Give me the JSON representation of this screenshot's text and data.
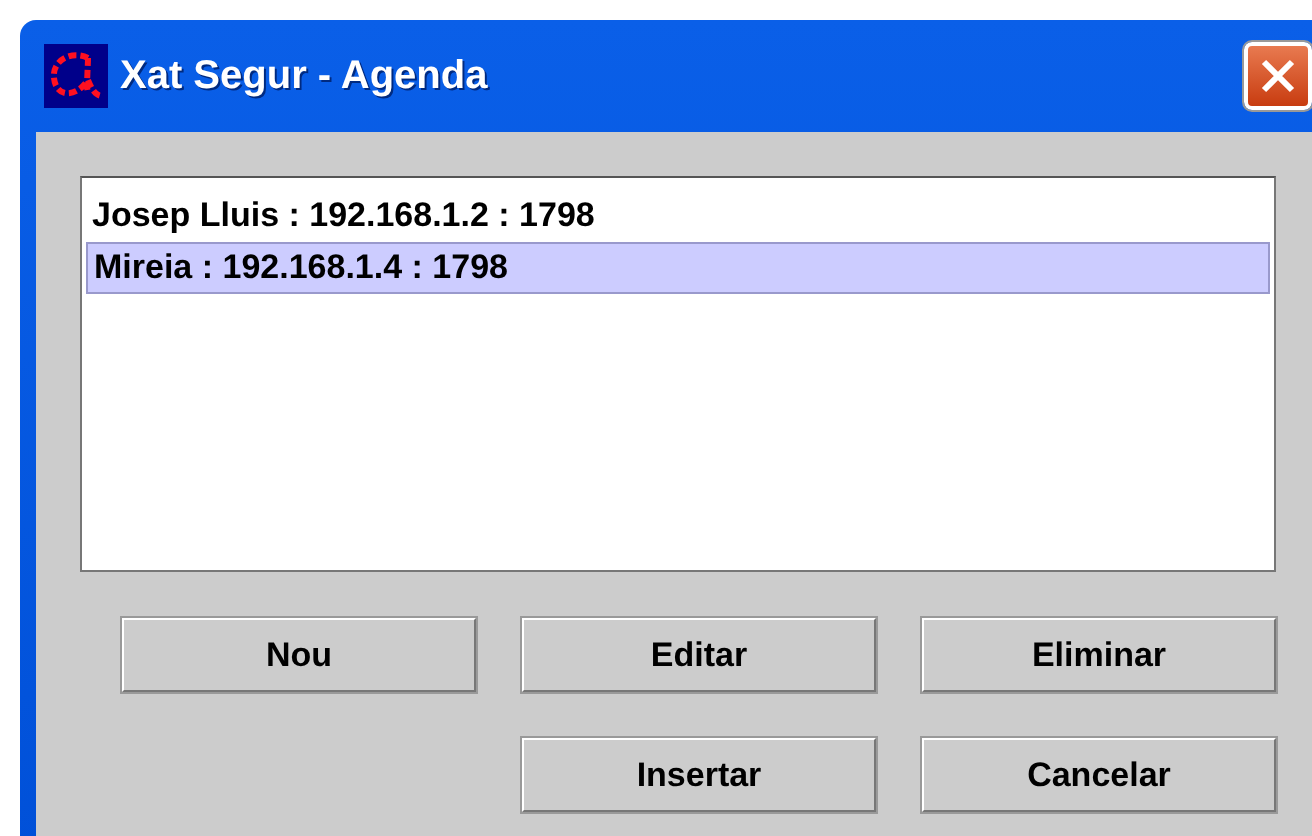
{
  "window": {
    "title": "Xat Segur - Agenda"
  },
  "contacts": [
    {
      "label": "Josep Lluis : 192.168.1.2 : 1798",
      "selected": false
    },
    {
      "label": "Mireia : 192.168.1.4 : 1798",
      "selected": true
    }
  ],
  "button_rows": [
    [
      "Nou",
      "Editar",
      "Eliminar"
    ],
    [
      "Insertar",
      "Cancelar"
    ]
  ]
}
